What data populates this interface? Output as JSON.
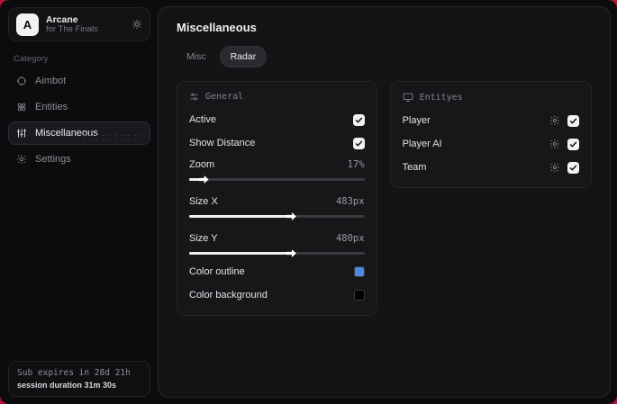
{
  "backdrop_color": "#b31335",
  "sidebar": {
    "brand": {
      "initial": "A",
      "title": "Arcane",
      "subtitle": "for The Finals"
    },
    "category_label": "Category",
    "items": [
      {
        "label": "Aimbot",
        "icon": "crosshair-icon",
        "active": false
      },
      {
        "label": "Entities",
        "icon": "atom-icon",
        "active": false
      },
      {
        "label": "Miscellaneous",
        "icon": "sliders-vertical-icon",
        "active": true
      },
      {
        "label": "Settings",
        "icon": "gear-icon",
        "active": false
      }
    ],
    "subscription": {
      "line1": "Sub expires in 28d 21h",
      "line2": "session duration 31m 30s"
    }
  },
  "main": {
    "title": "Miscellaneous",
    "tabs": [
      {
        "label": "Misc",
        "active": false
      },
      {
        "label": "Radar",
        "active": true
      }
    ],
    "general_panel": {
      "header": "General",
      "header_icon": "sliders-horizontal-icon",
      "toggles": [
        {
          "label": "Active",
          "checked": true
        },
        {
          "label": "Show Distance",
          "checked": true
        }
      ],
      "sliders": [
        {
          "label": "Zoom",
          "value": "17%",
          "fill_pct": 7
        },
        {
          "label": "Size X",
          "value": "483px",
          "fill_pct": 57
        },
        {
          "label": "Size Y",
          "value": "480px",
          "fill_pct": 57
        }
      ],
      "colors": [
        {
          "label": "Color outline",
          "value": "#4d8ae0"
        },
        {
          "label": "Color background",
          "value": "#000000"
        }
      ]
    },
    "entities_panel": {
      "header": "Entityes",
      "header_icon": "monitor-icon",
      "rows": [
        {
          "label": "Player",
          "checked": true
        },
        {
          "label": "Player AI",
          "checked": true
        },
        {
          "label": "Team",
          "checked": true
        }
      ]
    }
  }
}
